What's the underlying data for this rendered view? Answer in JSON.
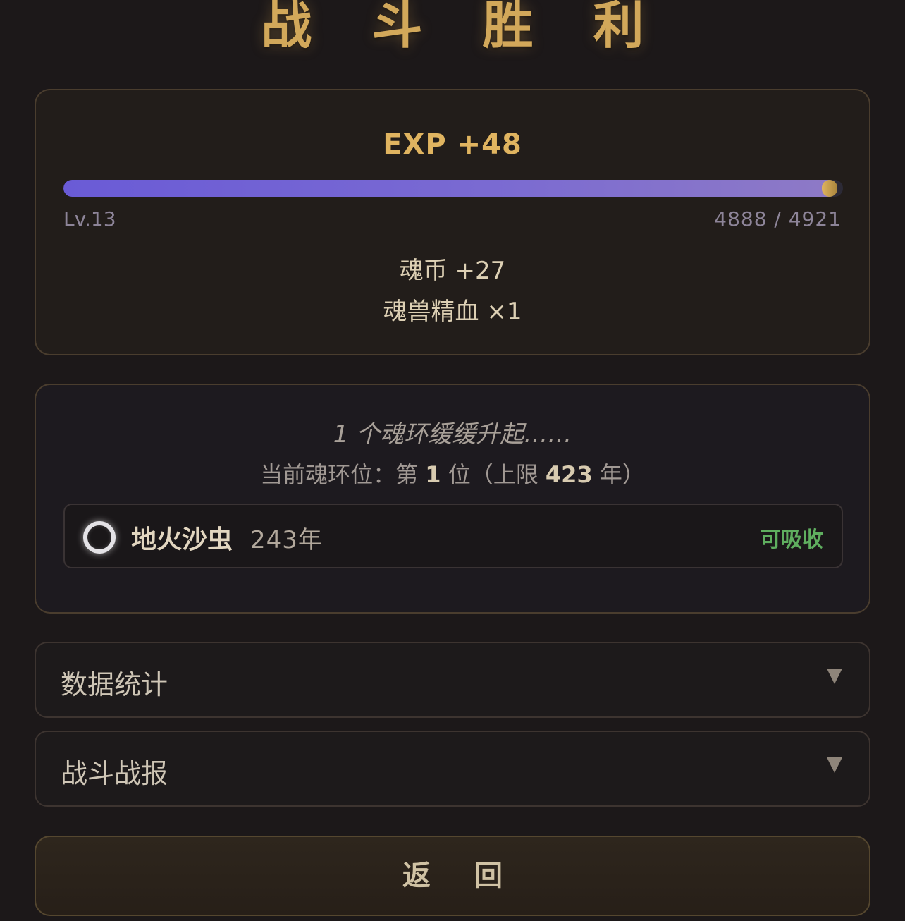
{
  "title": "战 斗 胜 利",
  "exp": {
    "title": "EXP +48",
    "level": "Lv.13",
    "count": "4888 / 4921",
    "progress": 0.993
  },
  "rewards": {
    "coins": "魂币 +27",
    "item": "魂兽精血 ×1"
  },
  "ring": {
    "rising_text": "1 个魂环缓缓升起……",
    "slot_prefix": "当前魂环位：第",
    "slot_number": "1",
    "slot_mid": "位（上限",
    "limit": "423",
    "slot_suffix": "年）",
    "name": "地火沙虫",
    "years": "243年",
    "status": "可吸收",
    "ring_color": "#e4e2e6",
    "status_color": "#5fae5f"
  },
  "sections": {
    "stats": "数据统计",
    "report": "战斗战报",
    "arrow_icon": "triangle-down-icon"
  },
  "back_button": "返 回",
  "colors": {
    "accent": "#d2a85a",
    "exp_bar": "#6a5bd6",
    "background": "#1c1819"
  }
}
